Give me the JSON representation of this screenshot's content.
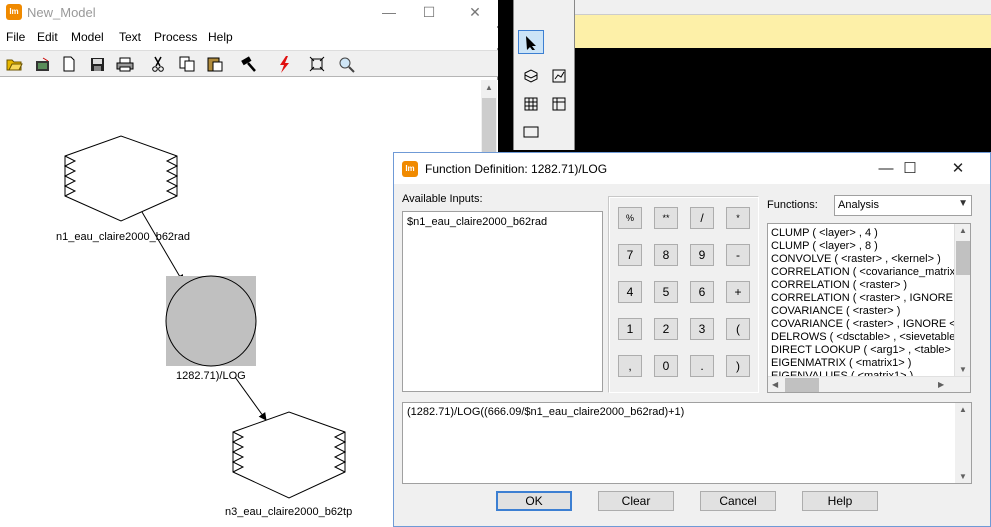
{
  "model_window": {
    "title": "New_Model",
    "controls": {
      "minimize": "—",
      "maximize": "☐",
      "close": "✕"
    },
    "menu": [
      "File",
      "Edit",
      "Model",
      "Text",
      "Process",
      "Help"
    ],
    "toolbar_icons": [
      "open-folder-icon",
      "open-model-icon",
      "new-file-icon",
      "save-icon",
      "print-icon",
      "cut-icon",
      "copy-icon",
      "paste-icon",
      "hammer-icon",
      "lightning-icon",
      "fit-icon",
      "zoom-icon"
    ],
    "nodes": {
      "input_raster": "n1_eau_claire2000_b62rad",
      "function": "1282.71)/LOG",
      "output_raster": "n3_eau_claire2000_b62tp"
    }
  },
  "palette": {
    "tools": [
      "select-arrow-icon",
      "raster-icon",
      "vector-icon",
      "matrix-icon",
      "table-icon",
      "text-box-icon"
    ]
  },
  "function_dialog": {
    "title": "Function Definition:  1282.71)/LOG",
    "controls": {
      "minimize": "—",
      "maximize": "☐",
      "close": "✕"
    },
    "available_inputs_label": "Available Inputs:",
    "available_inputs": [
      "$n1_eau_claire2000_b62rad"
    ],
    "keypad": [
      [
        "%",
        "**",
        "/",
        "*"
      ],
      [
        "7",
        "8",
        "9",
        "-"
      ],
      [
        "4",
        "5",
        "6",
        "+"
      ],
      [
        "1",
        "2",
        "3",
        "("
      ],
      [
        ",",
        "0",
        ".",
        ")"
      ]
    ],
    "functions_label": "Functions:",
    "functions_category": "Analysis",
    "functions": [
      "CLUMP ( <layer> , 4 )",
      "CLUMP ( <layer> , 8 )",
      "CONVOLVE ( <raster> , <kernel> )",
      "CORRELATION ( <covariance_matrix>",
      "CORRELATION ( <raster> )",
      "CORRELATION ( <raster> , IGNORE <",
      "COVARIANCE ( <raster> )",
      "COVARIANCE ( <raster> , IGNORE <v",
      "DELROWS ( <dsctable> , <sievetable>",
      "DIRECT LOOKUP ( <arg1> , <table> )",
      "EIGENMATRIX ( <matrix1> )",
      "EIGENVALUES ( <matrix1> )"
    ],
    "expression": "(1282.71)/LOG((666.09/$n1_eau_claire2000_b62rad)+1)",
    "buttons": {
      "ok": "OK",
      "clear": "Clear",
      "cancel": "Cancel",
      "help": "Help"
    }
  }
}
